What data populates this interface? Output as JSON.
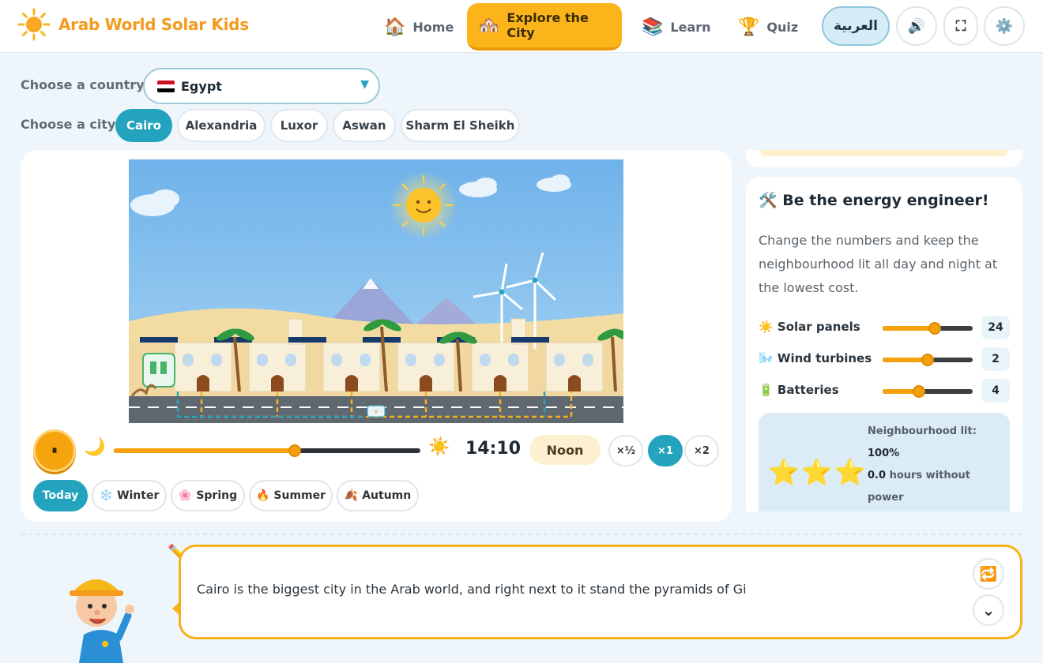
{
  "app": {
    "title": "Arab World Solar Kids",
    "logo_icon": "sun-icon"
  },
  "nav": [
    {
      "label": "Home",
      "emoji": "🏠",
      "icon": "home-icon"
    },
    {
      "label": "Explore the City",
      "emoji": "🏘️",
      "icon": "city-icon",
      "active": true
    },
    {
      "label": "Learn",
      "emoji": "📚",
      "icon": "books-icon"
    },
    {
      "label": "Quiz",
      "emoji": "🏆",
      "icon": "trophy-icon"
    }
  ],
  "header_buttons": {
    "language": "العربية",
    "sound": "🔊",
    "fullscreen": "⛶",
    "settings": "⚙️"
  },
  "country": {
    "label": "Choose a country",
    "selected": "Egypt"
  },
  "city": {
    "label": "Choose a city",
    "options": [
      "Cairo",
      "Alexandria",
      "Luxor",
      "Aswan",
      "Sharm El Sheikh"
    ],
    "selected": "Cairo"
  },
  "playback": {
    "play_glyph": "⏸",
    "moon": "🌙",
    "sun": "☀️",
    "time": "14:10",
    "time_fraction": 0.59,
    "phase": "Noon",
    "speeds": [
      "×½",
      "×1",
      "×2"
    ],
    "active_speed": "×1"
  },
  "seasons": [
    {
      "label": "Today",
      "emoji": "",
      "active": true
    },
    {
      "label": "Winter",
      "emoji": "❄️"
    },
    {
      "label": "Spring",
      "emoji": "🌸"
    },
    {
      "label": "Summer",
      "emoji": "🔥"
    },
    {
      "label": "Autumn",
      "emoji": "🍂"
    }
  ],
  "engineer": {
    "title_emoji": "🛠️",
    "title": "Be the energy engineer!",
    "description": "Change the numbers and keep the neighbourhood lit all day and night at the lowest cost.",
    "controls": [
      {
        "emoji": "☀️",
        "label": "Solar panels",
        "value": "24",
        "fraction": 0.58
      },
      {
        "emoji": "🌬️",
        "label": "Wind turbines",
        "value": "2",
        "fraction": 0.5
      },
      {
        "emoji": "🔋",
        "label": "Batteries",
        "value": "4",
        "fraction": 0.4
      }
    ],
    "result": {
      "stars": "⭐⭐⭐",
      "star_count": 3,
      "lit_label": "Neighbourhood lit:",
      "lit_value": "100%",
      "hours_value": "0.0",
      "hours_label": "hours without power"
    }
  },
  "guide": {
    "text": "Cairo is the biggest city in the Arab world, and right next to it stand the pyramids of Gi",
    "replay_icon": "🔁",
    "more_icon": "⌄"
  },
  "colors": {
    "accent": "#24a3be",
    "brand": "#f39a1f",
    "highlight": "#fbb51a"
  }
}
